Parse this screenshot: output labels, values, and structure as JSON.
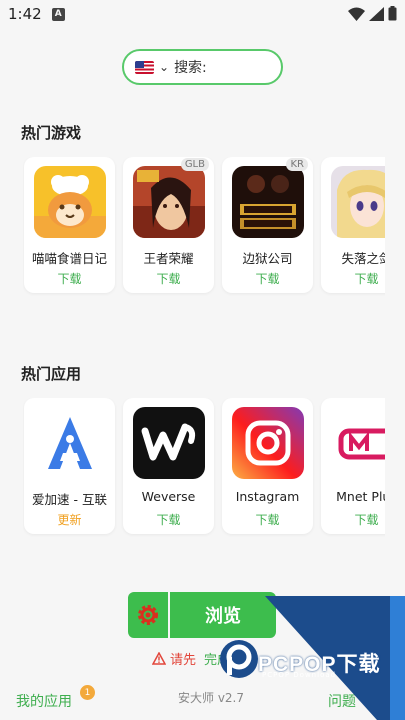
{
  "status_bar": {
    "time": "1:42",
    "notif_letter": "A"
  },
  "search": {
    "placeholder": "搜索:"
  },
  "hot_games": {
    "title": "热门游戏",
    "items": [
      {
        "name": "喵喵食谱日记",
        "action": "下载",
        "badge": ""
      },
      {
        "name": "王者荣耀",
        "action": "下载",
        "badge": "GLB"
      },
      {
        "name": "边狱公司",
        "action": "下载",
        "badge": "KR"
      },
      {
        "name": "失落之剑",
        "action": "下载",
        "badge": ""
      }
    ]
  },
  "hot_apps": {
    "title": "热门应用",
    "items": [
      {
        "name": "爱加速 - 互联",
        "action": "更新"
      },
      {
        "name": "Weverse",
        "action": "下载"
      },
      {
        "name": "Instagram",
        "action": "下载"
      },
      {
        "name": "Mnet Plus",
        "action": "下载"
      }
    ]
  },
  "browse_button": {
    "label": "浏览"
  },
  "notice": {
    "text": "请先",
    "green_text": "完成"
  },
  "bottom": {
    "my_apps": "我的应用",
    "badge_count": "1",
    "version": "安大师 v2.7",
    "right_label": "问题"
  },
  "watermark": {
    "brand": "PCPOP下载",
    "sub": "PCPOP Download"
  },
  "colors": {
    "accent": "#3dbd4d",
    "update": "#f0a020",
    "alert": "#e2463b"
  }
}
